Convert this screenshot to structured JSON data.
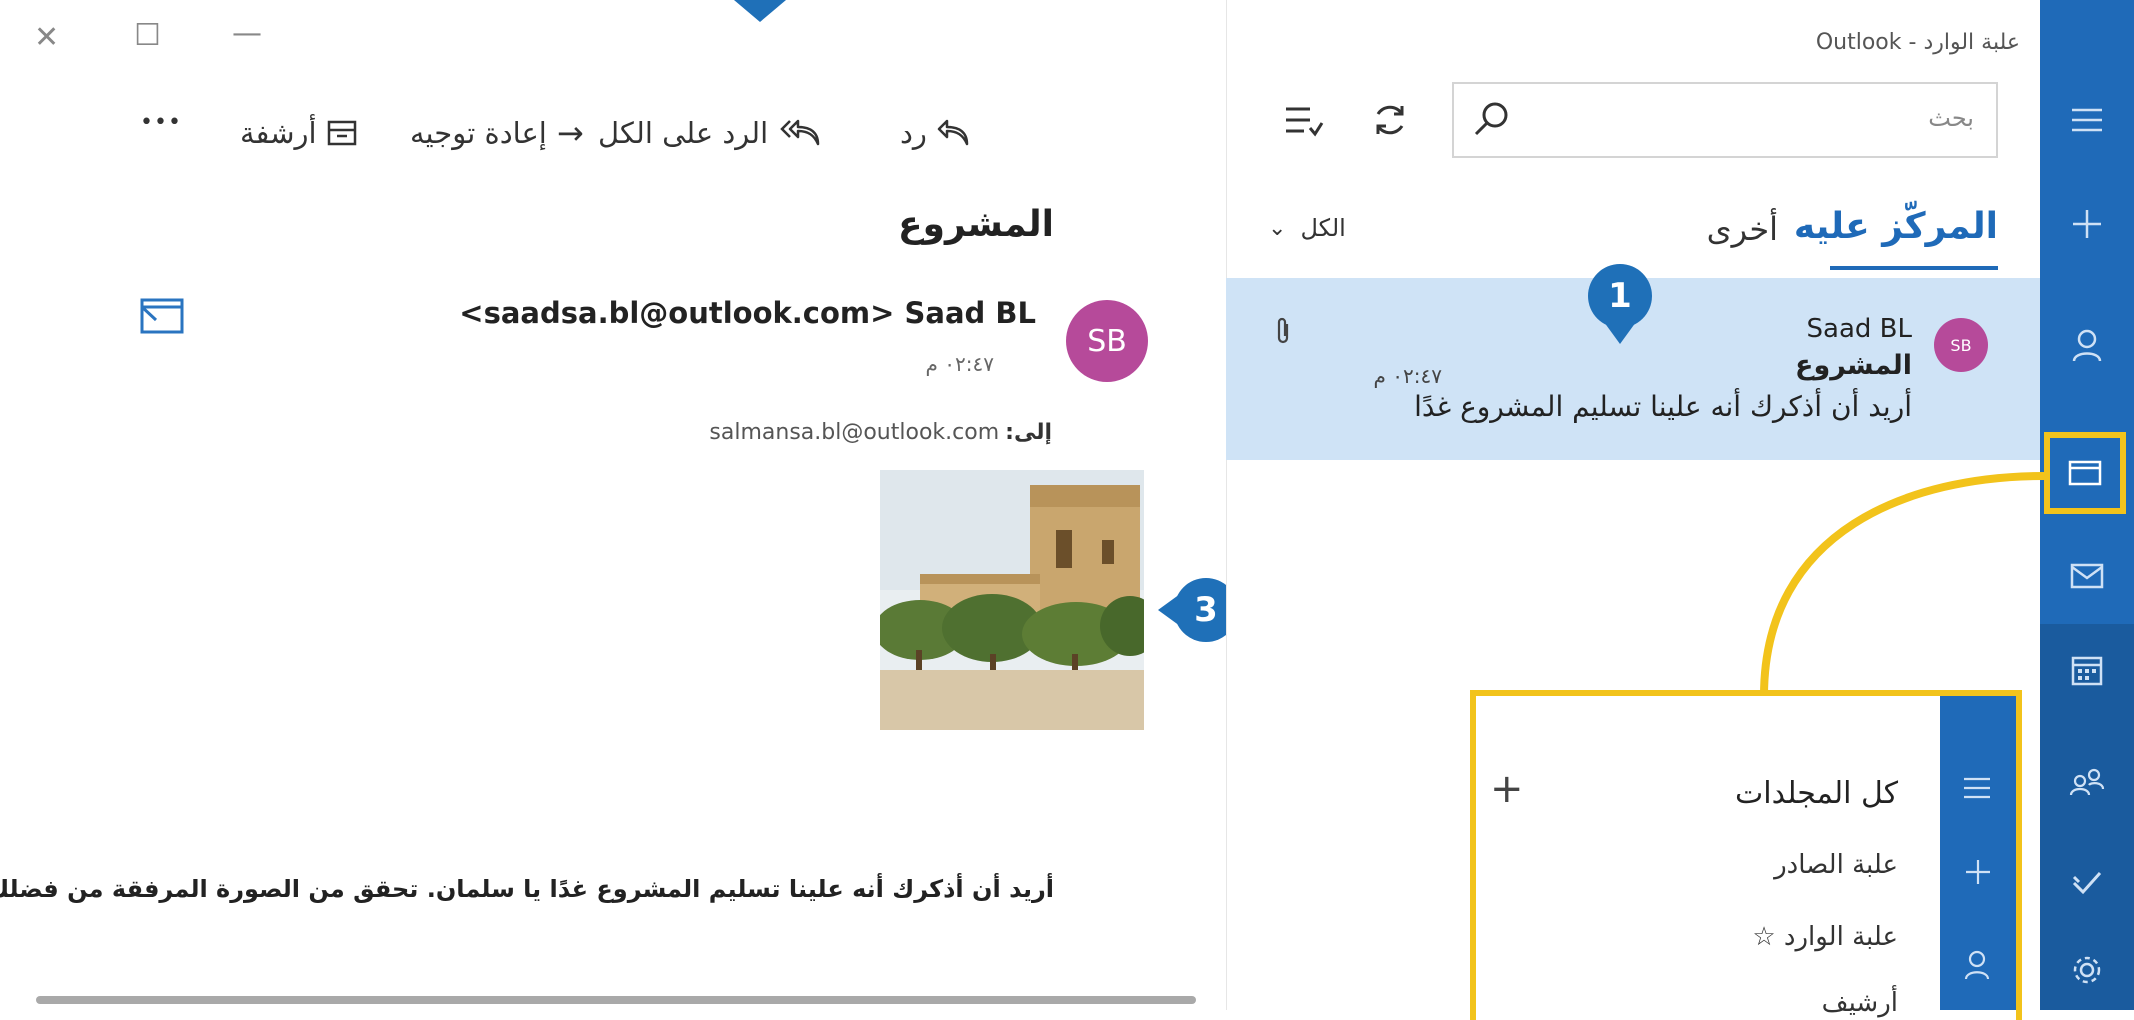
{
  "window": {
    "title": "علبة الوارد - Outlook",
    "controls": {
      "close": "✕",
      "maximize": "☐",
      "minimize": "—"
    }
  },
  "reading_toolbar": {
    "reply": "رد",
    "reply_all": "الرد على الكل",
    "forward": "إعادة توجيه",
    "archive": "أرشفة",
    "more": "•••"
  },
  "message": {
    "subject": "المشروع",
    "avatar_initials": "SB",
    "sender": "<saadsa.bl@outlook.com> Saad BL",
    "time": "٠٢:٤٧ م",
    "to_label": "إلى:",
    "to_address": "salmansa.bl@outlook.com",
    "body": "أريد أن أذكرك أنه علينا تسليم المشروع غدًا يا سلمان. تحقق من الصورة المرفقة من فضلك."
  },
  "list": {
    "search_placeholder": "بحث",
    "tabs": {
      "focused": "المركّز عليه",
      "other": "أخرى"
    },
    "filter": "الكل",
    "items": [
      {
        "avatar_initials": "SB",
        "sender": "Saad BL",
        "subject": "المشروع",
        "preview": "أريد أن أذكرك أنه علينا تسليم المشروع غدًا",
        "time": "٠٢:٤٧ م"
      }
    ]
  },
  "callouts": {
    "one": "1",
    "three": "3"
  },
  "folders_popup": {
    "title": "كل المجلدات",
    "add": "+",
    "items": [
      "علبة الصادر",
      "علبة الوارد ☆",
      "أرشيف"
    ]
  },
  "colors": {
    "accent": "#1f6ab8",
    "highlight": "#f2c31b",
    "selection": "#cfe3f6",
    "avatar": "#b64a9a"
  }
}
